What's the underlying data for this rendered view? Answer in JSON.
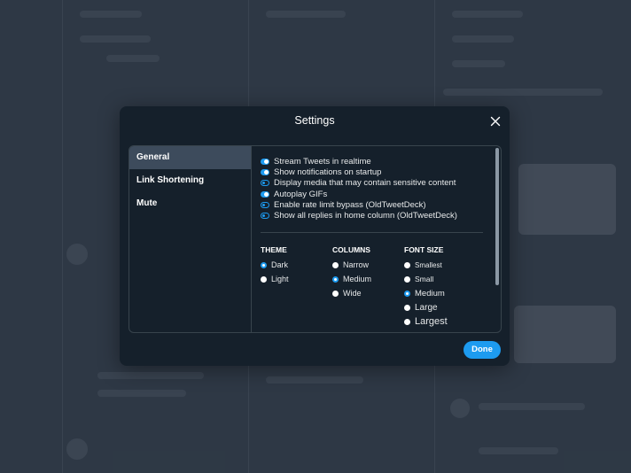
{
  "modal": {
    "title": "Settings",
    "close_icon": "close-icon",
    "done_label": "Done"
  },
  "sidebar": {
    "items": [
      {
        "label": "General",
        "active": true
      },
      {
        "label": "Link Shortening",
        "active": false
      },
      {
        "label": "Mute",
        "active": false
      }
    ]
  },
  "general": {
    "toggles": [
      {
        "label": "Stream Tweets in realtime",
        "on": true
      },
      {
        "label": "Show notifications on startup",
        "on": true
      },
      {
        "label": "Display media that may contain sensitive content",
        "on": false
      },
      {
        "label": "Autoplay GIFs",
        "on": true
      },
      {
        "label": "Enable rate limit bypass (OldTweetDeck)",
        "on": false
      },
      {
        "label": "Show all replies in home column (OldTweetDeck)",
        "on": false
      }
    ],
    "theme": {
      "title": "THEME",
      "options": [
        "Dark",
        "Light"
      ],
      "selected": "Dark"
    },
    "columns": {
      "title": "COLUMNS",
      "options": [
        "Narrow",
        "Medium",
        "Wide"
      ],
      "selected": "Medium"
    },
    "font_size": {
      "title": "FONT SIZE",
      "options": [
        "Smallest",
        "Small",
        "Medium",
        "Large",
        "Largest"
      ],
      "selected": "Medium"
    }
  },
  "colors": {
    "accent": "#1d9bf0",
    "modal_bg": "#15202b",
    "active_nav": "#3d4b5c"
  }
}
